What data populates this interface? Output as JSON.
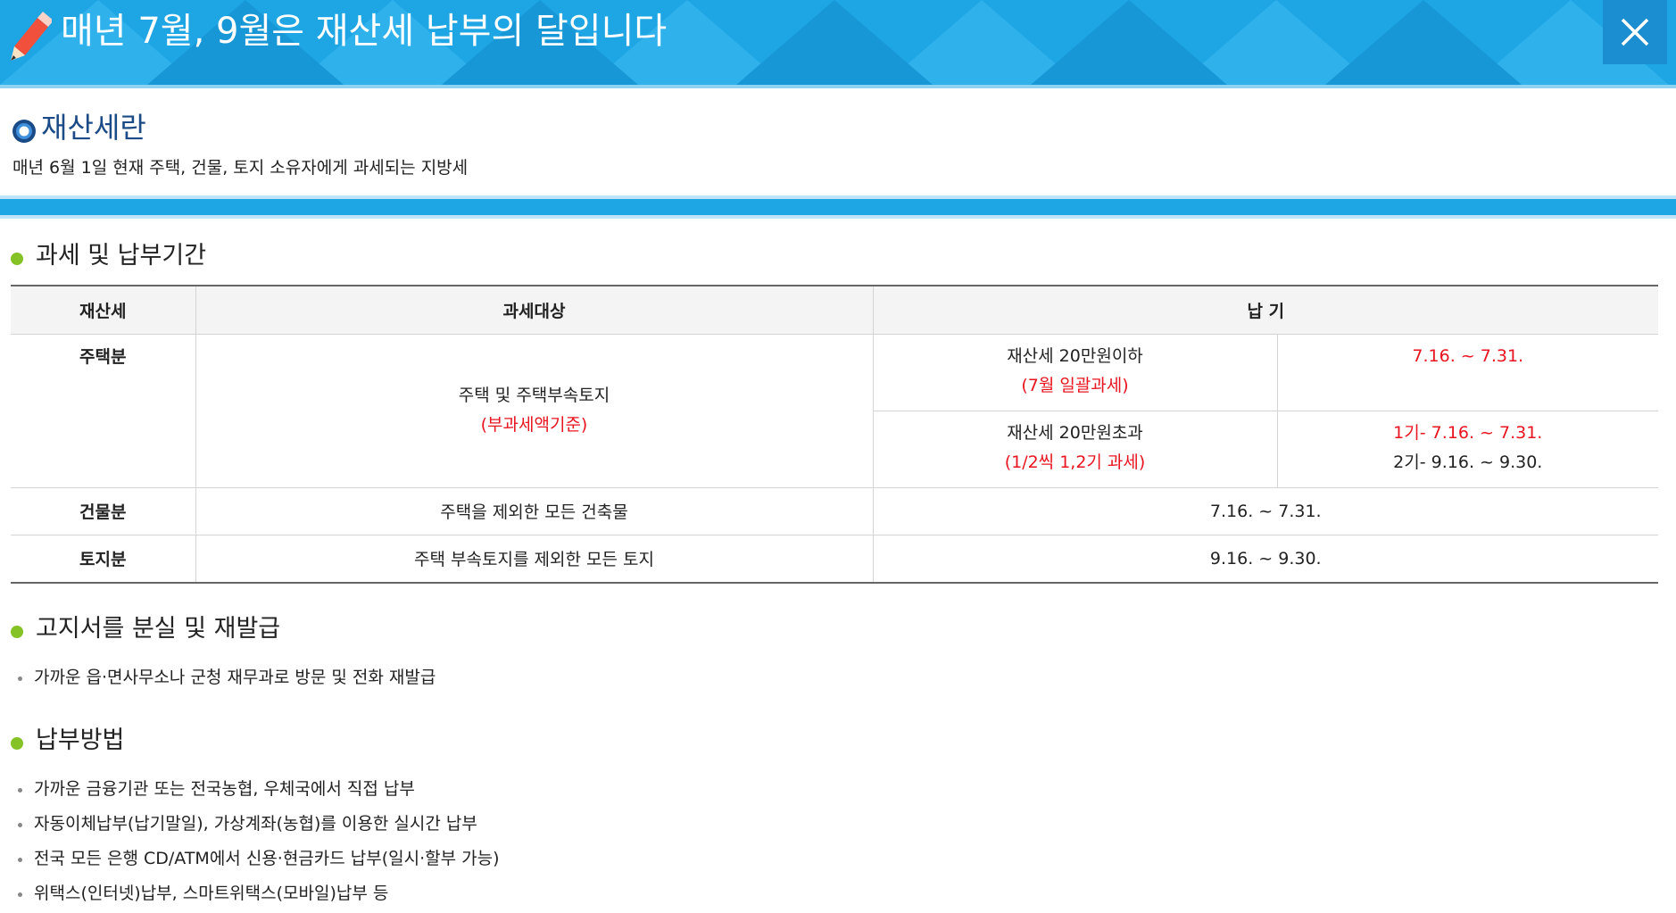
{
  "header": {
    "title": "매년 7월, 9월은 재산세 납부의 달입니다",
    "close_icon": "close-icon",
    "pencil_icon": "pencil-icon"
  },
  "intro": {
    "title": "재산세란",
    "description": "매년 6월 1일 현재 주택, 건물, 토지 소유자에게 과세되는 지방세"
  },
  "section_period": {
    "heading": "과세 및 납부기간",
    "table": {
      "headers": [
        "재산세",
        "과세대상",
        "납 기"
      ],
      "housing": {
        "label": "주택분",
        "target_line1": "주택 및 주택부속토지",
        "target_line2": "(부과세액기준)",
        "sub_a": {
          "cond_line1": "재산세 20만원이하",
          "cond_line2": "(7월 일괄과세)",
          "period": "7.16. ~ 7.31."
        },
        "sub_b": {
          "cond_line1": "재산세 20만원초과",
          "cond_line2": "(1/2씩 1,2기 과세)",
          "period_line1": "1기- 7.16. ~ 7.31.",
          "period_line2": "2기- 9.16. ~ 9.30."
        }
      },
      "building": {
        "label": "건물분",
        "target": "주택을 제외한 모든 건축물",
        "period": "7.16. ~ 7.31."
      },
      "land": {
        "label": "토지분",
        "target": "주택 부속토지를 제외한 모든 토지",
        "period": "9.16. ~ 9.30."
      }
    }
  },
  "section_lost": {
    "heading": "고지서를 분실 및 재발급",
    "items": [
      "가까운 읍·면사무소나 군청 재무과로 방문 및 전화 재발급"
    ]
  },
  "section_payment": {
    "heading": "납부방법",
    "items": [
      "가까운 금융기관 또는 전국농협, 우체국에서 직접 납부",
      "자동이체납부(납기말일), 가상계좌(농협)를 이용한 실시간 납부",
      "전국 모든 은행 CD/ATM에서 신용·현금카드 납부(일시·할부 가능)",
      "위택스(인터넷)납부, 스마트위택스(모바일)납부 등"
    ]
  },
  "colors": {
    "header_bg": "#1ea5e4",
    "accent_red": "#e8141f",
    "heading_blue": "#1b4b86",
    "bullet_green": "#84c225"
  }
}
